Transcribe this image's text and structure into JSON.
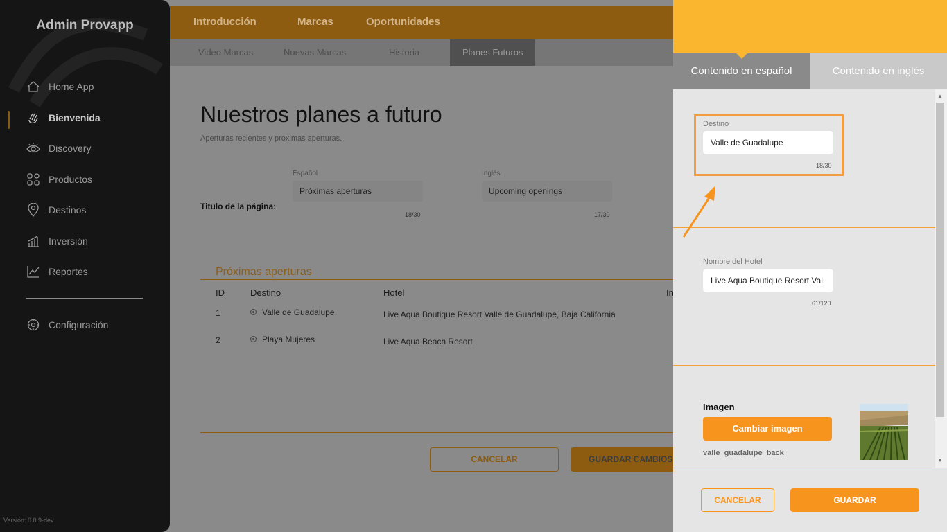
{
  "app": {
    "title": "Admin Provapp",
    "version": "Versión: 0.0.9-dev"
  },
  "sidebar": {
    "items": [
      {
        "label": "Home App",
        "icon": "home-icon"
      },
      {
        "label": "Bienvenida",
        "icon": "hand-wave-icon",
        "active": true
      },
      {
        "label": "Discovery",
        "icon": "eye-icon"
      },
      {
        "label": "Productos",
        "icon": "grid-icon"
      },
      {
        "label": "Destinos",
        "icon": "map-pin-icon"
      },
      {
        "label": "Inversión",
        "icon": "bar-chart-icon"
      },
      {
        "label": "Reportes",
        "icon": "line-chart-icon"
      }
    ],
    "settings": {
      "label": "Configuración",
      "icon": "gear-icon"
    }
  },
  "topnav": {
    "tabs": [
      "Introducción",
      "Marcas",
      "Oportunidades"
    ],
    "active": "Marcas"
  },
  "subnav": {
    "tabs": [
      "Video Marcas",
      "Nuevas Marcas",
      "Historia",
      "Planes Futuros"
    ],
    "active": "Planes Futuros"
  },
  "main": {
    "title": "Nuestros planes a futuro",
    "subtitle": "Aperturas recientes y próximas aperturas.",
    "page_title_label": "Titulo de la página:",
    "spanish": {
      "caption": "Español",
      "value": "Próximas aperturas",
      "counter": "18/30"
    },
    "english": {
      "caption": "Inglés",
      "value": "Upcoming openings",
      "counter": "17/30"
    },
    "section_title": "Próximas aperturas",
    "table": {
      "headers": [
        "ID",
        "Destino",
        "Hotel",
        "In"
      ],
      "rows": [
        {
          "id": "1",
          "destino": "Valle de Guadalupe",
          "hotel": "Live Aqua Boutique Resort Valle de Guadalupe, Baja California"
        },
        {
          "id": "2",
          "destino": "Playa Mujeres",
          "hotel": "Live Aqua Beach Resort"
        }
      ]
    },
    "cancel_label": "CANCELAR",
    "save_label": "GUARDAR CAMBIOS"
  },
  "panel": {
    "tabs": {
      "spanish": "Contenido en español",
      "english": "Contenido en inglés"
    },
    "destino": {
      "caption": "Destino",
      "value": "Valle de Guadalupe",
      "counter": "18/30"
    },
    "hotel": {
      "caption": "Nombre del Hotel",
      "value": "Live Aqua Boutique Resort Val",
      "counter": "61/120"
    },
    "image": {
      "label": "Imagen",
      "button": "Cambiar imagen",
      "filename": "valle_guadalupe_back"
    },
    "cancel_label": "CANCELAR",
    "save_label": "GUARDAR"
  },
  "colors": {
    "accent": "#f7941d",
    "header": "#fab62e",
    "sidebar": "#151515",
    "highlight": "#f19d41"
  }
}
